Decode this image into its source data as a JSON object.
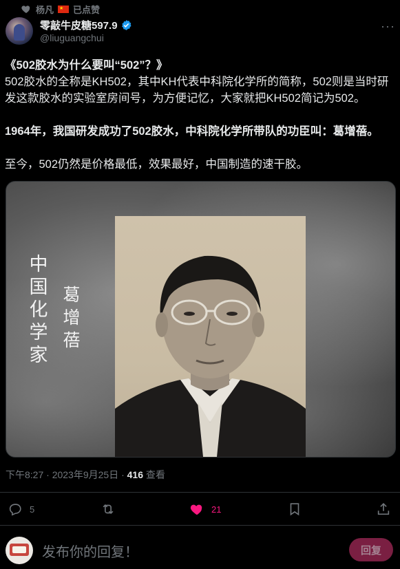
{
  "liked_by": {
    "name": "杨凡",
    "suffix": "已点赞"
  },
  "author": {
    "display_name": "零敲牛皮糖597.9",
    "handle": "@liuguangchui"
  },
  "post": {
    "line1": "《502胶水为什么要叫“502”？》",
    "line2": "502胶水的全称是KH502，其中KH代表中科院化学所的简称，502则是当时研发这款胶水的实验室房间号，为方便记忆，大家就把KH502简记为502。",
    "line3": "1964年，我国研发成功了502胶水，中科院化学所带队的功臣叫：葛增蓓。",
    "line4": "至今，502仍然是价格最低，效果最好，中国制造的速干胶。"
  },
  "media": {
    "caption_left": "中国化学家",
    "caption_name": "葛增蓓"
  },
  "meta": {
    "time": "下午8:27 · 2023年9月25日 · ",
    "views": "416",
    "views_label": " 查看"
  },
  "actions": {
    "replies": "5",
    "likes": "21"
  },
  "reply": {
    "placeholder": "发布你的回复！",
    "button": "回复"
  },
  "colors": {
    "accent_like": "#f91880",
    "verified": "#1d9bf0",
    "reply_button": "#7a1f42"
  }
}
